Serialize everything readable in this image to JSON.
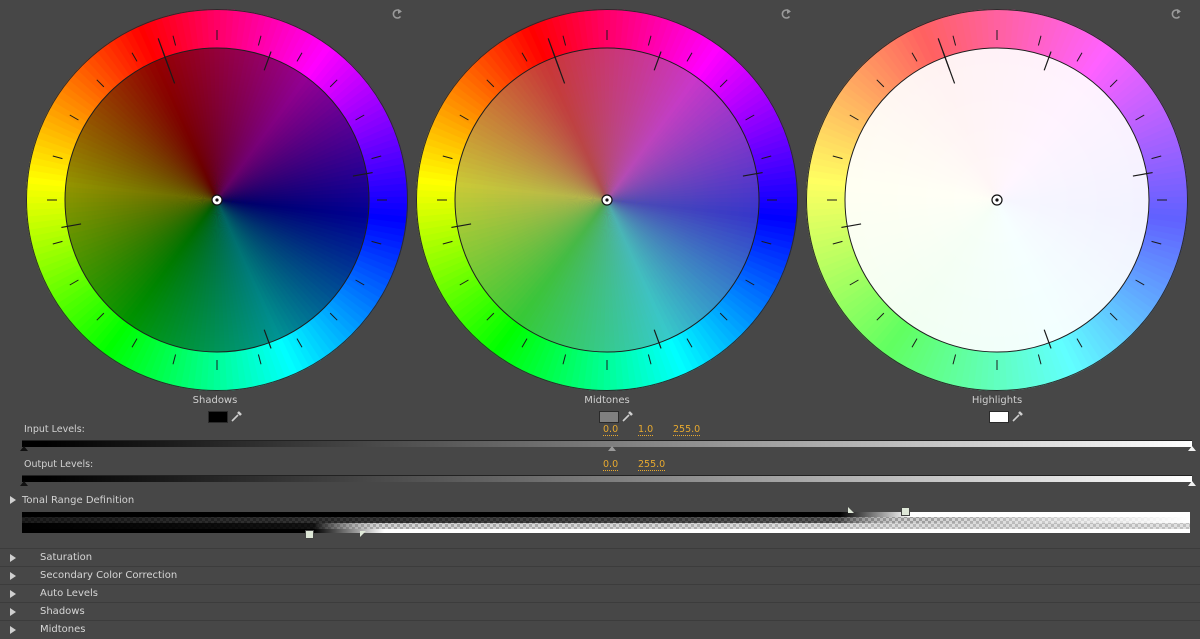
{
  "wheels": [
    {
      "label": "Shadows",
      "swatch": "#000000",
      "tint": "#000000",
      "tint_opacity": 0.42
    },
    {
      "label": "Midtones",
      "swatch": "#7f7f7f",
      "tint": "#808080",
      "tint_opacity": 0.42
    },
    {
      "label": "Highlights",
      "swatch": "#ffffff",
      "tint": "#ffffff",
      "tint_opacity": 0.82
    }
  ],
  "input_levels": {
    "label": "Input Levels:",
    "black": "0.0",
    "gamma": "1.0",
    "white": "255.0"
  },
  "output_levels": {
    "label": "Output Levels:",
    "black": "0.0",
    "white": "255.0"
  },
  "tonal_range": {
    "label": "Tonal Range Definition"
  },
  "sections": [
    {
      "label": "Saturation"
    },
    {
      "label": "Secondary Color Correction"
    },
    {
      "label": "Auto Levels"
    },
    {
      "label": "Shadows"
    },
    {
      "label": "Midtones"
    }
  ],
  "icons": {
    "reset": "reset-icon",
    "dropper": "eyedropper-icon",
    "expand": "triangle-right-icon"
  }
}
